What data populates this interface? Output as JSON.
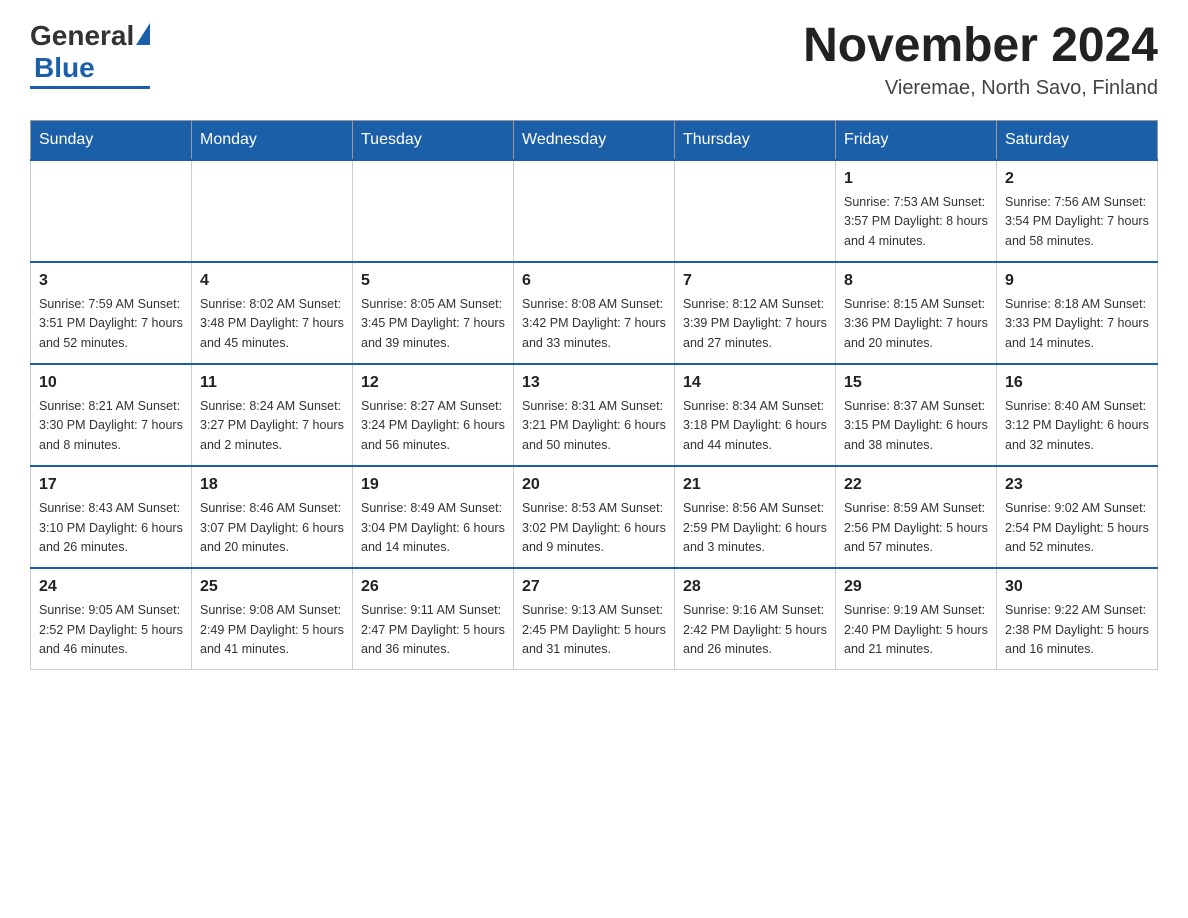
{
  "header": {
    "logo_general": "General",
    "logo_blue": "Blue",
    "month_title": "November 2024",
    "location": "Vieremae, North Savo, Finland"
  },
  "weekdays": [
    "Sunday",
    "Monday",
    "Tuesday",
    "Wednesday",
    "Thursday",
    "Friday",
    "Saturday"
  ],
  "weeks": [
    [
      {
        "day": "",
        "info": ""
      },
      {
        "day": "",
        "info": ""
      },
      {
        "day": "",
        "info": ""
      },
      {
        "day": "",
        "info": ""
      },
      {
        "day": "",
        "info": ""
      },
      {
        "day": "1",
        "info": "Sunrise: 7:53 AM\nSunset: 3:57 PM\nDaylight: 8 hours\nand 4 minutes."
      },
      {
        "day": "2",
        "info": "Sunrise: 7:56 AM\nSunset: 3:54 PM\nDaylight: 7 hours\nand 58 minutes."
      }
    ],
    [
      {
        "day": "3",
        "info": "Sunrise: 7:59 AM\nSunset: 3:51 PM\nDaylight: 7 hours\nand 52 minutes."
      },
      {
        "day": "4",
        "info": "Sunrise: 8:02 AM\nSunset: 3:48 PM\nDaylight: 7 hours\nand 45 minutes."
      },
      {
        "day": "5",
        "info": "Sunrise: 8:05 AM\nSunset: 3:45 PM\nDaylight: 7 hours\nand 39 minutes."
      },
      {
        "day": "6",
        "info": "Sunrise: 8:08 AM\nSunset: 3:42 PM\nDaylight: 7 hours\nand 33 minutes."
      },
      {
        "day": "7",
        "info": "Sunrise: 8:12 AM\nSunset: 3:39 PM\nDaylight: 7 hours\nand 27 minutes."
      },
      {
        "day": "8",
        "info": "Sunrise: 8:15 AM\nSunset: 3:36 PM\nDaylight: 7 hours\nand 20 minutes."
      },
      {
        "day": "9",
        "info": "Sunrise: 8:18 AM\nSunset: 3:33 PM\nDaylight: 7 hours\nand 14 minutes."
      }
    ],
    [
      {
        "day": "10",
        "info": "Sunrise: 8:21 AM\nSunset: 3:30 PM\nDaylight: 7 hours\nand 8 minutes."
      },
      {
        "day": "11",
        "info": "Sunrise: 8:24 AM\nSunset: 3:27 PM\nDaylight: 7 hours\nand 2 minutes."
      },
      {
        "day": "12",
        "info": "Sunrise: 8:27 AM\nSunset: 3:24 PM\nDaylight: 6 hours\nand 56 minutes."
      },
      {
        "day": "13",
        "info": "Sunrise: 8:31 AM\nSunset: 3:21 PM\nDaylight: 6 hours\nand 50 minutes."
      },
      {
        "day": "14",
        "info": "Sunrise: 8:34 AM\nSunset: 3:18 PM\nDaylight: 6 hours\nand 44 minutes."
      },
      {
        "day": "15",
        "info": "Sunrise: 8:37 AM\nSunset: 3:15 PM\nDaylight: 6 hours\nand 38 minutes."
      },
      {
        "day": "16",
        "info": "Sunrise: 8:40 AM\nSunset: 3:12 PM\nDaylight: 6 hours\nand 32 minutes."
      }
    ],
    [
      {
        "day": "17",
        "info": "Sunrise: 8:43 AM\nSunset: 3:10 PM\nDaylight: 6 hours\nand 26 minutes."
      },
      {
        "day": "18",
        "info": "Sunrise: 8:46 AM\nSunset: 3:07 PM\nDaylight: 6 hours\nand 20 minutes."
      },
      {
        "day": "19",
        "info": "Sunrise: 8:49 AM\nSunset: 3:04 PM\nDaylight: 6 hours\nand 14 minutes."
      },
      {
        "day": "20",
        "info": "Sunrise: 8:53 AM\nSunset: 3:02 PM\nDaylight: 6 hours\nand 9 minutes."
      },
      {
        "day": "21",
        "info": "Sunrise: 8:56 AM\nSunset: 2:59 PM\nDaylight: 6 hours\nand 3 minutes."
      },
      {
        "day": "22",
        "info": "Sunrise: 8:59 AM\nSunset: 2:56 PM\nDaylight: 5 hours\nand 57 minutes."
      },
      {
        "day": "23",
        "info": "Sunrise: 9:02 AM\nSunset: 2:54 PM\nDaylight: 5 hours\nand 52 minutes."
      }
    ],
    [
      {
        "day": "24",
        "info": "Sunrise: 9:05 AM\nSunset: 2:52 PM\nDaylight: 5 hours\nand 46 minutes."
      },
      {
        "day": "25",
        "info": "Sunrise: 9:08 AM\nSunset: 2:49 PM\nDaylight: 5 hours\nand 41 minutes."
      },
      {
        "day": "26",
        "info": "Sunrise: 9:11 AM\nSunset: 2:47 PM\nDaylight: 5 hours\nand 36 minutes."
      },
      {
        "day": "27",
        "info": "Sunrise: 9:13 AM\nSunset: 2:45 PM\nDaylight: 5 hours\nand 31 minutes."
      },
      {
        "day": "28",
        "info": "Sunrise: 9:16 AM\nSunset: 2:42 PM\nDaylight: 5 hours\nand 26 minutes."
      },
      {
        "day": "29",
        "info": "Sunrise: 9:19 AM\nSunset: 2:40 PM\nDaylight: 5 hours\nand 21 minutes."
      },
      {
        "day": "30",
        "info": "Sunrise: 9:22 AM\nSunset: 2:38 PM\nDaylight: 5 hours\nand 16 minutes."
      }
    ]
  ]
}
